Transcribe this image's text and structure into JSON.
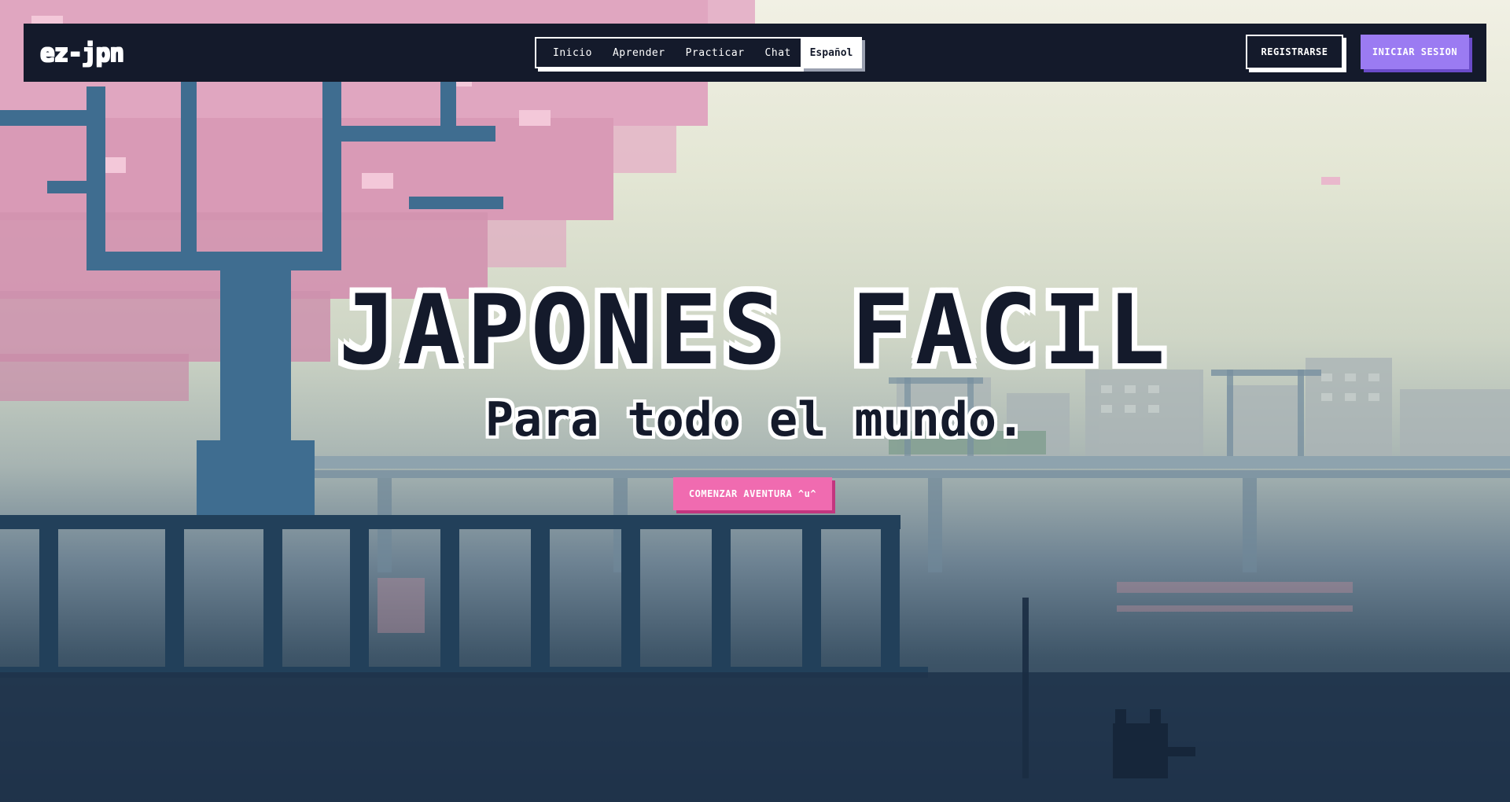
{
  "navbar": {
    "logo": "ez-jpn",
    "links": [
      {
        "label": "Inicio"
      },
      {
        "label": "Aprender"
      },
      {
        "label": "Practicar"
      },
      {
        "label": "Chat"
      }
    ],
    "language": "Español",
    "register_label": "REGISTRARSE",
    "login_label": "INICIAR SESION"
  },
  "hero": {
    "title": "JAPONES FACIL",
    "subtitle": "Para todo el mundo.",
    "cta_label": "COMENZAR AVENTURA ^u^"
  },
  "colors": {
    "navbar_bg": "#141a2b",
    "login_accent": "#9b7bf2",
    "cta_accent": "#f06bb0",
    "blossom_pink": "#e3a5c0",
    "tree_trunk": "#3d6a8c",
    "railing": "#1f3a52"
  }
}
